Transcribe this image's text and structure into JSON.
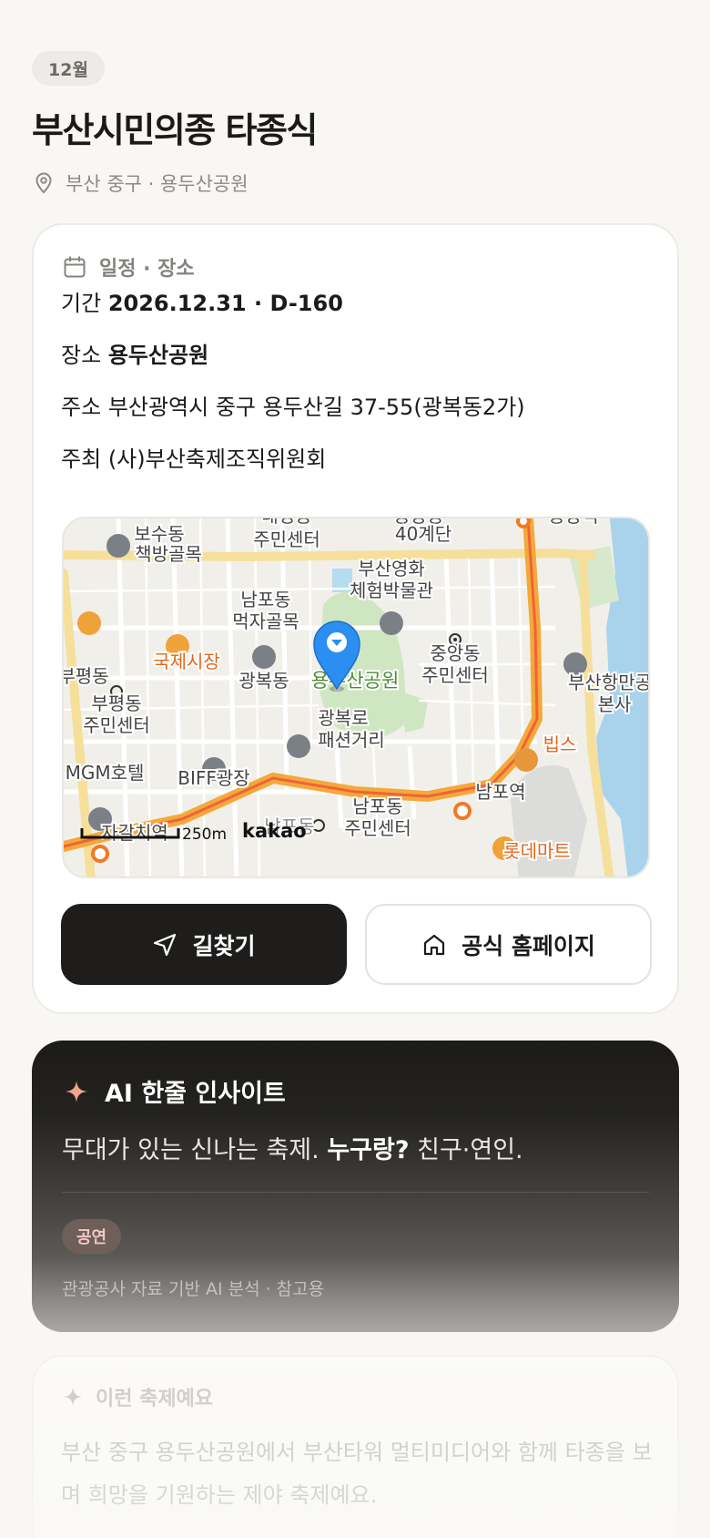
{
  "header": {
    "month_badge": "12월",
    "title": "부산시민의종 타종식",
    "location": "부산 중구 · 용두산공원"
  },
  "info_card": {
    "heading": "일정 · 장소",
    "period_label": "기간",
    "period_value": "2026.12.31 · D-160",
    "venue_label": "장소",
    "venue_value": "용두산공원",
    "address_label": "주소",
    "address_value": "부산광역시 중구 용두산길 37-55(광복동2가)",
    "host_label": "주최",
    "host_value": "(사)부산축제조직위원회",
    "map": {
      "labels": {
        "bosudong": "보수동",
        "bosudong2": "책방골목",
        "daecheong": "대청동",
        "daecheong2": "주민센터",
        "gyedan": "40계단",
        "dongkwang": "동광동",
        "jungangyeok": "중앙역",
        "film": "부산영화",
        "film2": "체험박물관",
        "nampo_food": "남포동",
        "nampo_food2": "먹자골목",
        "gukje": "국제시장",
        "gwangbok": "광복동",
        "yongdusan": "용두산공원",
        "jungang": "중앙동",
        "jungang2": "주민센터",
        "port": "부산항만공",
        "port2": "본사",
        "bupyeong": "부평동",
        "bupyeong_c": "부평동",
        "bupyeong_c2": "주민센터",
        "fashion": "광복로",
        "fashion2": "패션거리",
        "bips": "빕스",
        "mgm": "MGM호텔",
        "biff": "BIFF광장",
        "nampoyeok": "남포역",
        "nampo_c": "남포동",
        "nampo_c2": "주민센터",
        "jagalchi": "자갈치역",
        "nampodong": "남포동",
        "lotte": "롯데마트",
        "scale": "250m",
        "brand": "kakao"
      }
    },
    "directions_label": "길찾기",
    "homepage_label": "공식 홈페이지"
  },
  "ai_card": {
    "heading": "AI 한줄 인사이트",
    "line_prefix": "무대가 있는 신나는 축제.",
    "line_bold": "누구랑?",
    "line_suffix": "친구·연인.",
    "tag": "공연",
    "note": "관광공사 자료 기반 AI 분석 · 참고용"
  },
  "desc_card": {
    "heading": "이런 축제예요",
    "text": "부산 중구 용두산공원에서 부산타워 멀티미디어와 함께 타종을 보며 희망을 기원하는 제야 축제예요."
  },
  "colors": {
    "dark_button": "#1e1d1b",
    "map_pin": "#2b8ef0",
    "road_major": "#f3a93a",
    "park": "#cfe6c2",
    "water": "#a9d3ea"
  }
}
